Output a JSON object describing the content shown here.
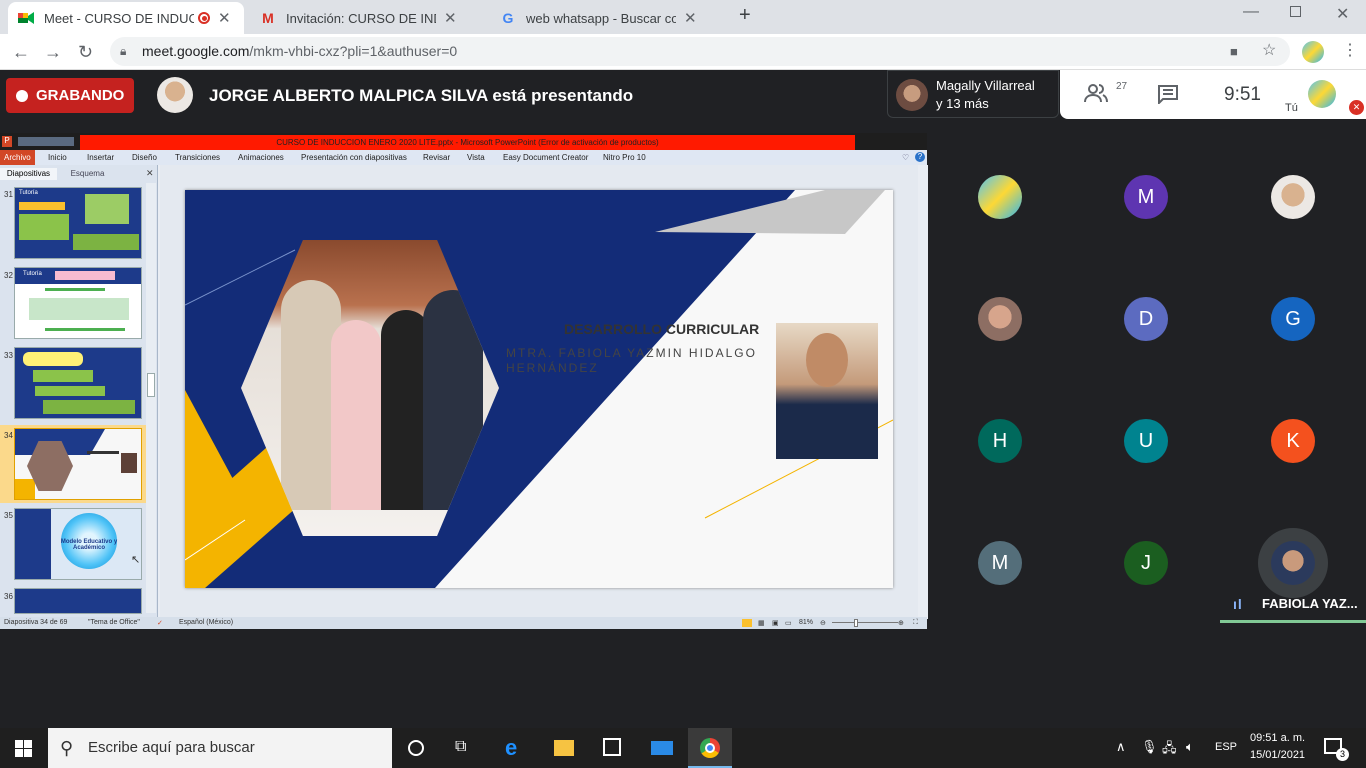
{
  "browser": {
    "tabs": [
      {
        "title": "Meet - CURSO DE INDUCCIÓ",
        "favicon": "meet-icon",
        "active": true
      },
      {
        "title": "Invitación: CURSO DE INDUCCIÓ",
        "favicon": "gmail-icon",
        "active": false
      },
      {
        "title": "web whatsapp - Buscar con Goo",
        "favicon": "google-icon",
        "active": false
      }
    ],
    "url_host": "meet.google.com",
    "url_path": "/mkm-vhbi-cxz?pli=1&authuser=0"
  },
  "meet": {
    "recording_label": "GRABANDO",
    "presenting_text": "JORGE ALBERTO MALPICA SILVA está presentando",
    "viewers_name": "Magally Villarreal",
    "viewers_more": "y 13 más",
    "participant_count": "27",
    "clock": "9:51",
    "self_label": "Tú",
    "speaker_name": "FABIOLA YAZ...",
    "participants": [
      {
        "initial": "",
        "color": "#1a73e8",
        "type": "image"
      },
      {
        "initial": "M",
        "color": "#5e35b1"
      },
      {
        "initial": "",
        "color": "#9e9e9e",
        "type": "image"
      },
      {
        "initial": "",
        "color": "#bdbdbd",
        "type": "image"
      },
      {
        "initial": "D",
        "color": "#5c6bc0"
      },
      {
        "initial": "G",
        "color": "#1565c0"
      },
      {
        "initial": "H",
        "color": "#00695c"
      },
      {
        "initial": "U",
        "color": "#00838f"
      },
      {
        "initial": "K",
        "color": "#f4511e"
      },
      {
        "initial": "M",
        "color": "#546e7a"
      },
      {
        "initial": "J",
        "color": "#1b5e20"
      }
    ]
  },
  "ppt": {
    "window_title": "CURSO DE INDUCCION ENERO 2020 LITE.pptx - Microsoft PowerPoint (Error de activación de productos)",
    "ribbon_tabs": [
      "Archivo",
      "Inicio",
      "Insertar",
      "Diseño",
      "Transiciones",
      "Animaciones",
      "Presentación con diapositivas",
      "Revisar",
      "Vista",
      "Easy Document Creator",
      "Nitro Pro 10"
    ],
    "panel_tabs": [
      "Diapositivas",
      "Esquema"
    ],
    "thumb_numbers": [
      "31",
      "32",
      "33",
      "34",
      "35",
      "36"
    ],
    "slide_title": "DESARROLLO CURRICULAR",
    "slide_subtitle_1": "MTRA. FABIOLA YAZMIN HIDALGO",
    "slide_subtitle_2": "HERNÁNDEZ",
    "status_slide": "Diapositiva 34 de 69",
    "status_theme": "\"Tema de Office\"",
    "status_lang": "Español (México)",
    "zoom": "81%",
    "thumb_texts": {
      "t31": "Tutoría",
      "t32": "Tutoría",
      "t35": "Modelo Educativo y Académico"
    }
  },
  "taskbar": {
    "search_placeholder": "Escribe aquí para buscar",
    "lang": "ESP",
    "time": "09:51 a. m.",
    "date": "15/01/2021",
    "notifications": "3"
  }
}
